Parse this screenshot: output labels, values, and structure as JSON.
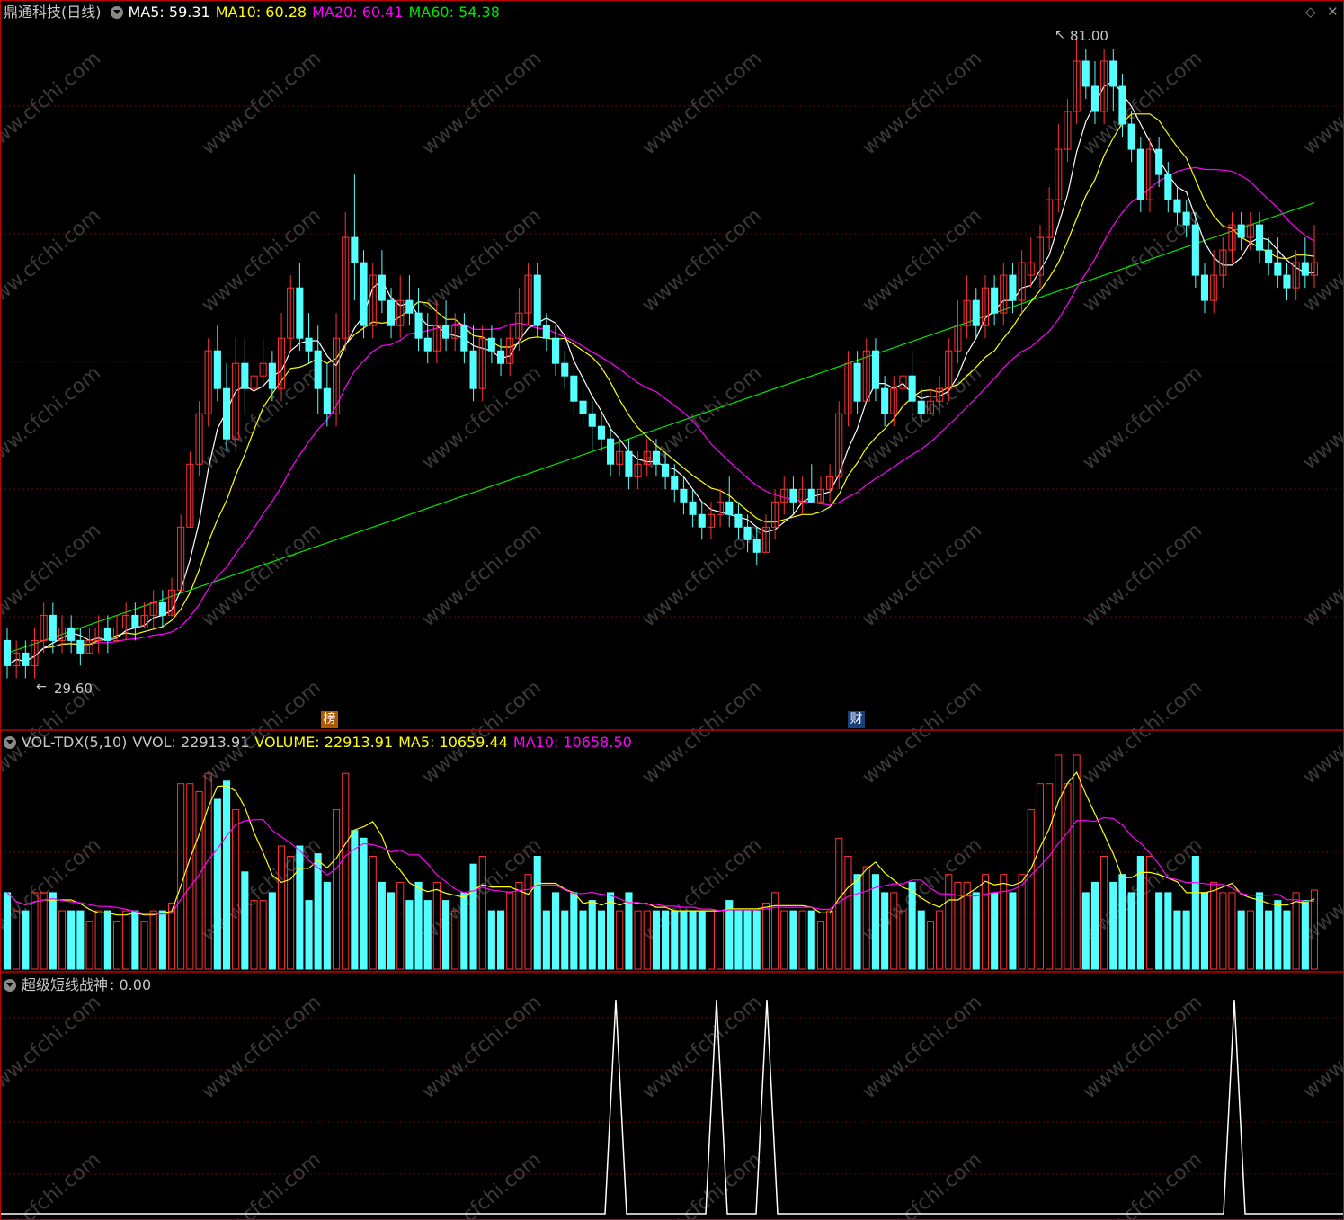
{
  "main": {
    "stock_name": "鼎通科技(日线)",
    "ma5": "MA5: 59.31",
    "ma10": "MA10: 60.28",
    "ma20": "MA20: 60.41",
    "ma60": "MA60: 54.38",
    "high_label": "81.00",
    "low_label": "29.60",
    "marker_bang": "榜",
    "marker_cai": "财"
  },
  "volume": {
    "indicator": "VOL-TDX(5,10)",
    "vvol": "VVOL: 22913.91",
    "volume": "VOLUME: 22913.91",
    "ma5": "MA5: 10659.44",
    "ma10": "MA10: 10658.50"
  },
  "signal": {
    "name": "超级短线战神",
    "value": ": 0.00"
  },
  "watermark": "www.cfchi.com",
  "colors": {
    "up": "#ff3232",
    "down": "#54ffff",
    "ma5": "#ffffff",
    "ma10": "#ffff00",
    "ma20": "#ff00ff",
    "ma60": "#00e600",
    "grid": "#7a0000"
  },
  "chart_data": {
    "type": "candlestick",
    "y_range": [
      29.6,
      81.0
    ],
    "candles": [
      [
        33,
        31,
        34,
        30,
        0
      ],
      [
        31,
        32,
        33,
        30,
        1
      ],
      [
        32,
        31,
        33,
        30,
        0
      ],
      [
        31,
        33,
        34,
        30,
        1
      ],
      [
        33,
        35,
        36,
        32,
        1
      ],
      [
        35,
        33,
        36,
        32,
        0
      ],
      [
        33,
        34,
        35,
        32,
        1
      ],
      [
        34,
        33,
        35,
        32,
        0
      ],
      [
        33,
        32,
        34,
        31,
        0
      ],
      [
        32,
        33,
        34,
        32,
        1
      ],
      [
        33,
        34,
        35,
        32,
        1
      ],
      [
        34,
        33,
        35,
        32,
        0
      ],
      [
        33,
        34,
        35,
        33,
        1
      ],
      [
        34,
        35,
        36,
        33,
        1
      ],
      [
        35,
        34,
        36,
        33,
        0
      ],
      [
        34,
        35,
        36,
        34,
        1
      ],
      [
        35,
        36,
        37,
        34,
        1
      ],
      [
        36,
        35,
        37,
        34,
        0
      ],
      [
        35,
        37,
        38,
        35,
        1
      ],
      [
        37,
        42,
        43,
        37,
        1
      ],
      [
        42,
        47,
        48,
        42,
        1
      ],
      [
        47,
        51,
        52,
        46,
        1
      ],
      [
        51,
        56,
        57,
        50,
        1
      ],
      [
        56,
        53,
        58,
        52,
        0
      ],
      [
        53,
        49,
        55,
        48,
        0
      ],
      [
        49,
        55,
        57,
        48,
        1
      ],
      [
        55,
        53,
        57,
        51,
        0
      ],
      [
        53,
        54,
        56,
        52,
        1
      ],
      [
        54,
        55,
        57,
        53,
        1
      ],
      [
        55,
        53,
        56,
        52,
        0
      ],
      [
        53,
        57,
        59,
        52,
        1
      ],
      [
        57,
        61,
        62,
        56,
        1
      ],
      [
        61,
        57,
        63,
        56,
        0
      ],
      [
        57,
        56,
        59,
        55,
        0
      ],
      [
        56,
        53,
        58,
        51,
        0
      ],
      [
        53,
        51,
        55,
        50,
        0
      ],
      [
        51,
        57,
        59,
        50,
        1
      ],
      [
        57,
        65,
        67,
        56,
        1
      ],
      [
        65,
        63,
        70,
        60,
        0
      ],
      [
        63,
        58,
        64,
        57,
        0
      ],
      [
        58,
        62,
        63,
        57,
        1
      ],
      [
        62,
        60,
        64,
        59,
        0
      ],
      [
        60,
        58,
        61,
        57,
        0
      ],
      [
        58,
        60,
        62,
        57,
        1
      ],
      [
        60,
        59,
        62,
        58,
        0
      ],
      [
        59,
        57,
        61,
        56,
        0
      ],
      [
        57,
        56,
        59,
        55,
        0
      ],
      [
        56,
        58,
        60,
        55,
        1
      ],
      [
        58,
        57,
        60,
        56,
        0
      ],
      [
        57,
        58,
        59,
        56,
        1
      ],
      [
        58,
        56,
        59,
        55,
        0
      ],
      [
        56,
        53,
        58,
        52,
        0
      ],
      [
        53,
        57,
        58,
        52,
        1
      ],
      [
        57,
        56,
        58,
        55,
        0
      ],
      [
        56,
        55,
        57,
        54,
        0
      ],
      [
        55,
        57,
        58,
        54,
        1
      ],
      [
        57,
        59,
        61,
        56,
        1
      ],
      [
        59,
        62,
        63,
        58,
        1
      ],
      [
        62,
        58,
        63,
        57,
        0
      ],
      [
        58,
        57,
        59,
        56,
        0
      ],
      [
        57,
        55,
        58,
        54,
        0
      ],
      [
        55,
        54,
        56,
        53,
        0
      ],
      [
        54,
        52,
        55,
        51,
        0
      ],
      [
        52,
        51,
        53,
        50,
        0
      ],
      [
        51,
        50,
        52,
        48,
        0
      ],
      [
        50,
        49,
        51,
        48,
        0
      ],
      [
        49,
        47,
        50,
        46,
        0
      ],
      [
        47,
        48,
        49,
        46,
        1
      ],
      [
        48,
        46,
        49,
        45,
        0
      ],
      [
        46,
        47,
        48,
        45,
        1
      ],
      [
        47,
        48,
        49,
        46,
        1
      ],
      [
        48,
        47,
        49,
        46,
        0
      ],
      [
        47,
        46,
        48,
        45,
        0
      ],
      [
        46,
        45,
        47,
        44,
        0
      ],
      [
        45,
        44,
        46,
        43,
        0
      ],
      [
        44,
        43,
        45,
        42,
        0
      ],
      [
        43,
        42,
        44,
        41,
        0
      ],
      [
        42,
        43,
        44,
        41,
        1
      ],
      [
        43,
        44,
        45,
        42,
        1
      ],
      [
        44,
        43,
        46,
        42,
        0
      ],
      [
        43,
        42,
        44,
        41,
        0
      ],
      [
        42,
        41,
        43,
        40,
        0
      ],
      [
        41,
        40,
        42,
        39,
        0
      ],
      [
        40,
        42,
        43,
        40,
        1
      ],
      [
        42,
        44,
        45,
        41,
        1
      ],
      [
        44,
        45,
        46,
        43,
        1
      ],
      [
        45,
        44,
        46,
        43,
        0
      ],
      [
        44,
        45,
        46,
        43,
        1
      ],
      [
        45,
        44,
        47,
        44,
        0
      ],
      [
        44,
        45,
        46,
        44,
        1
      ],
      [
        45,
        46,
        47,
        44,
        1
      ],
      [
        46,
        51,
        52,
        45,
        1
      ],
      [
        51,
        55,
        56,
        50,
        1
      ],
      [
        55,
        52,
        56,
        51,
        0
      ],
      [
        52,
        56,
        57,
        52,
        1
      ],
      [
        56,
        53,
        57,
        52,
        0
      ],
      [
        53,
        51,
        54,
        50,
        0
      ],
      [
        51,
        53,
        54,
        50,
        1
      ],
      [
        53,
        54,
        55,
        52,
        1
      ],
      [
        54,
        52,
        56,
        51,
        0
      ],
      [
        52,
        51,
        53,
        50,
        0
      ],
      [
        51,
        52,
        53,
        51,
        1
      ],
      [
        52,
        53,
        54,
        51,
        1
      ],
      [
        53,
        56,
        57,
        52,
        1
      ],
      [
        56,
        58,
        60,
        55,
        1
      ],
      [
        58,
        60,
        62,
        57,
        1
      ],
      [
        60,
        58,
        61,
        57,
        0
      ],
      [
        58,
        61,
        62,
        57,
        1
      ],
      [
        61,
        59,
        62,
        58,
        0
      ],
      [
        59,
        62,
        63,
        58,
        1
      ],
      [
        62,
        60,
        63,
        59,
        0
      ],
      [
        60,
        63,
        64,
        59,
        1
      ],
      [
        63,
        62,
        65,
        61,
        1
      ],
      [
        62,
        65,
        66,
        61,
        1
      ],
      [
        65,
        68,
        69,
        64,
        1
      ],
      [
        68,
        72,
        74,
        67,
        1
      ],
      [
        72,
        75,
        76,
        71,
        1
      ],
      [
        75,
        79,
        81,
        74,
        1
      ],
      [
        79,
        77,
        80,
        76,
        0
      ],
      [
        77,
        75,
        79,
        74,
        0
      ],
      [
        75,
        79,
        80,
        74,
        1
      ],
      [
        79,
        77,
        80,
        75,
        0
      ],
      [
        77,
        74,
        78,
        73,
        0
      ],
      [
        74,
        72,
        75,
        71,
        0
      ],
      [
        72,
        68,
        73,
        67,
        0
      ],
      [
        68,
        72,
        73,
        67,
        1
      ],
      [
        72,
        70,
        73,
        69,
        0
      ],
      [
        70,
        68,
        71,
        67,
        0
      ],
      [
        68,
        67,
        69,
        66,
        0
      ],
      [
        67,
        66,
        68,
        65,
        0
      ],
      [
        66,
        62,
        67,
        61,
        0
      ],
      [
        62,
        60,
        63,
        59,
        0
      ],
      [
        60,
        62,
        64,
        59,
        1
      ],
      [
        62,
        64,
        65,
        61,
        1
      ],
      [
        64,
        66,
        67,
        63,
        1
      ],
      [
        66,
        65,
        67,
        64,
        0
      ],
      [
        65,
        66,
        67,
        64,
        1
      ],
      [
        66,
        64,
        67,
        63,
        0
      ],
      [
        64,
        63,
        65,
        62,
        0
      ],
      [
        63,
        62,
        65,
        61,
        0
      ],
      [
        62,
        61,
        63,
        60,
        0
      ],
      [
        61,
        63,
        64,
        60,
        1
      ],
      [
        63,
        62,
        65,
        61,
        0
      ],
      [
        62,
        63,
        66,
        61,
        1
      ]
    ],
    "peak_positions_pct": [
      0.0,
      0.0,
      0.0
    ]
  }
}
